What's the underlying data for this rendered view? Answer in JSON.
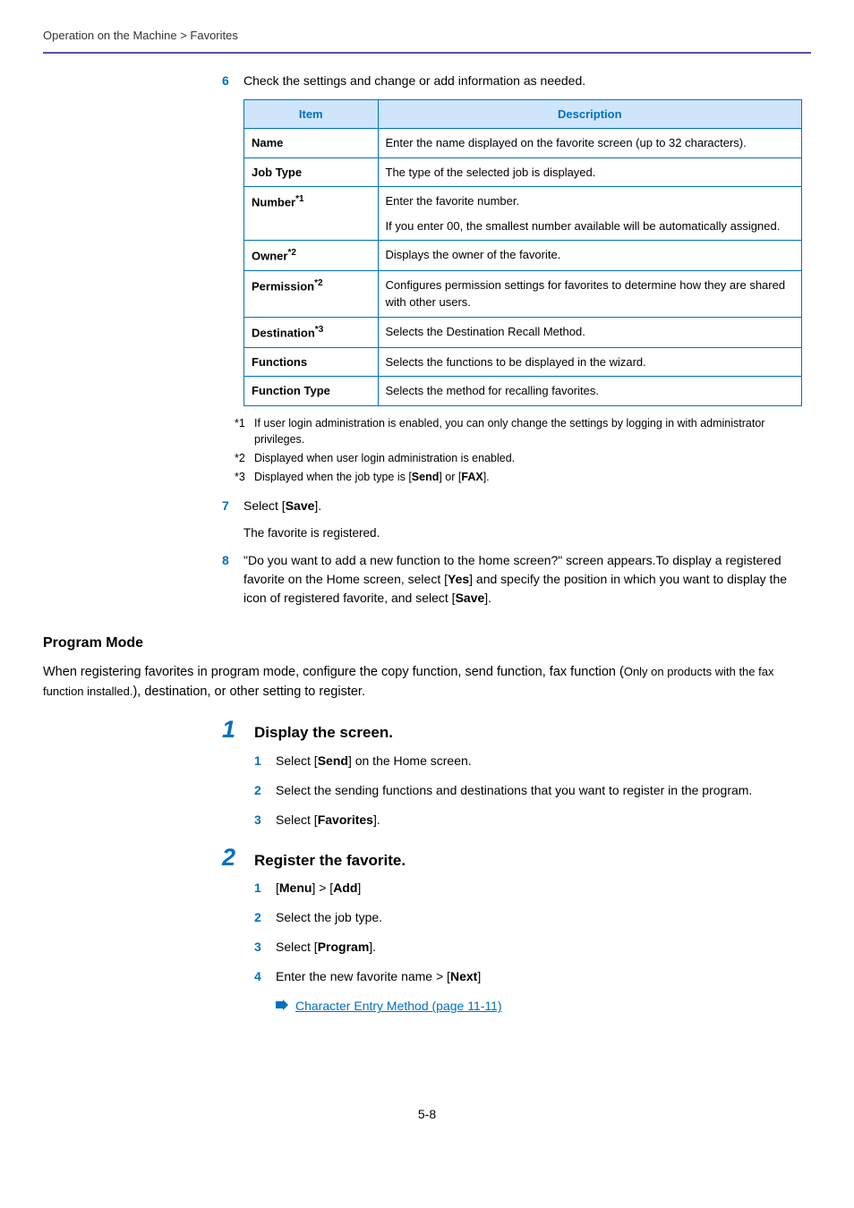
{
  "breadcrumb": "Operation on the Machine > Favorites",
  "step6": {
    "num": "6",
    "text": "Check the settings and change or add information as needed."
  },
  "table": {
    "headers": {
      "item": "Item",
      "desc": "Description"
    },
    "rows": [
      {
        "item": "Name",
        "sup": "",
        "desc": "Enter the name displayed on the favorite screen (up to 32 characters)."
      },
      {
        "item": "Job Type",
        "sup": "",
        "desc": "The type of the selected job is displayed."
      },
      {
        "item": "Number",
        "sup": "*1",
        "desc": "Enter the favorite number.\nIf you enter 00, the smallest number available will be automatically assigned."
      },
      {
        "item": "Owner",
        "sup": "*2",
        "desc": "Displays the owner of the favorite."
      },
      {
        "item": "Permission",
        "sup": "*2",
        "desc": "Configures permission settings for favorites to determine how they are shared with other users."
      },
      {
        "item": "Destination",
        "sup": "*3",
        "desc": "Selects the Destination Recall Method."
      },
      {
        "item": "Functions",
        "sup": "",
        "desc": "Selects the functions to be displayed in the wizard."
      },
      {
        "item": "Function Type",
        "sup": "",
        "desc": "Selects the method for recalling favorites."
      }
    ]
  },
  "footnotes": [
    {
      "mark": "*1",
      "text": "If user login administration is enabled, you can only change the settings by logging in with administrator privileges."
    },
    {
      "mark": "*2",
      "text": "Displayed when user login administration is enabled."
    },
    {
      "mark": "*3",
      "text_pre": "Displayed when the job type is [",
      "b1": "Send",
      "mid": "] or [",
      "b2": "FAX",
      "post": "]."
    }
  ],
  "step7": {
    "num": "7",
    "pre": "Select [",
    "bold": "Save",
    "post": "].",
    "sub": "The favorite is registered."
  },
  "step8": {
    "num": "8",
    "text1": "\"Do you want to add a new function to the home screen?\" screen appears.To display a registered favorite on the Home screen, select [",
    "b1": "Yes",
    "text2": "] and specify the position in which you want to display the icon of registered favorite, and select [",
    "b2": "Save",
    "text3": "]."
  },
  "program_mode": {
    "heading": "Program Mode",
    "para_a": "When registering favorites in program mode, configure the copy function, send function, fax function (",
    "para_small": "Only on products with the fax function installed.",
    "para_b": "), destination, or other setting to register."
  },
  "big1": {
    "num": "1",
    "title": "Display the screen.",
    "subs": [
      {
        "n": "1",
        "pre": "Select [",
        "b": "Send",
        "post": "] on the Home screen."
      },
      {
        "n": "2",
        "plain": "Select the sending functions and destinations that you want to register in the program."
      },
      {
        "n": "3",
        "pre": "Select [",
        "b": "Favorites",
        "post": "]."
      }
    ]
  },
  "big2": {
    "num": "2",
    "title": "Register the favorite.",
    "subs": [
      {
        "n": "1",
        "b1": "Menu",
        "mid": "] > [",
        "b2": "Add",
        "pre": "[",
        "post": "]"
      },
      {
        "n": "2",
        "plain": "Select the job type."
      },
      {
        "n": "3",
        "pre": "Select [",
        "b": "Program",
        "post": "]."
      },
      {
        "n": "4",
        "plain_a": "Enter the new favorite name > [",
        "b": "Next",
        "plain_b": "]"
      }
    ],
    "link": "Character Entry Method (page 11-11)"
  },
  "page_number": "5-8"
}
